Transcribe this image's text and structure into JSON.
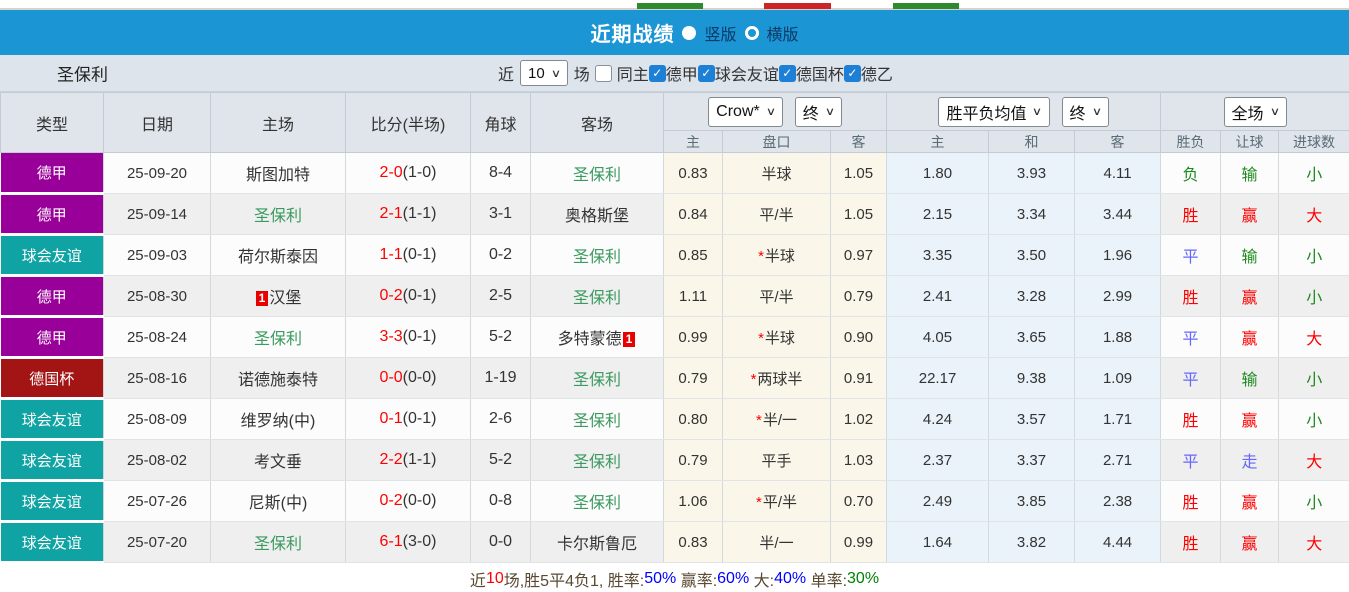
{
  "header": {
    "title": "近期战绩",
    "vertical_label": "竖版",
    "horizontal_label": "横版"
  },
  "filters": {
    "team": "圣保利",
    "recent_label": "近",
    "recent_value": "10",
    "matches_label": "场",
    "same_home_label": "同主",
    "leagues": [
      "德甲",
      "球会友谊",
      "德国杯",
      "德乙"
    ]
  },
  "table": {
    "headers": {
      "type": "类型",
      "date": "日期",
      "home": "主场",
      "score": "比分(半场)",
      "corners": "角球",
      "away": "客场",
      "sub": {
        "asian_home": "主",
        "handicap": "盘口",
        "asian_away": "客",
        "euro_home": "主",
        "euro_draw": "和",
        "euro_away": "客",
        "wdl": "胜负",
        "handicap_result": "让球",
        "goals": "进球数"
      }
    },
    "selects": {
      "asian": "Crow*",
      "asian_state": "终",
      "euro": "胜平负均值",
      "euro_state": "终",
      "result": "全场"
    },
    "rows": [
      {
        "type": "德甲",
        "type_color": "purple",
        "date": "25-09-20",
        "home": {
          "name": "斯图加特",
          "self": false,
          "badge": null
        },
        "score": {
          "full": "2-0",
          "half": "(1-0)"
        },
        "corners": "8-4",
        "away": {
          "name": "圣保利",
          "self": true,
          "badge": null
        },
        "asian": {
          "home": "0.83",
          "handicap": "半球",
          "star": false,
          "away": "1.05"
        },
        "euro": {
          "home": "1.80",
          "draw": "3.93",
          "away": "4.11"
        },
        "result": {
          "wdl": "负",
          "wdl_color": "green",
          "handicap": "输",
          "handicap_color": "green",
          "goals": "小",
          "goals_color": "green"
        }
      },
      {
        "type": "德甲",
        "type_color": "purple",
        "date": "25-09-14",
        "home": {
          "name": "圣保利",
          "self": true,
          "badge": null
        },
        "score": {
          "full": "2-1",
          "half": "(1-1)"
        },
        "corners": "3-1",
        "away": {
          "name": "奥格斯堡",
          "self": false,
          "badge": null
        },
        "asian": {
          "home": "0.84",
          "handicap": "平/半",
          "star": false,
          "away": "1.05"
        },
        "euro": {
          "home": "2.15",
          "draw": "3.34",
          "away": "3.44"
        },
        "result": {
          "wdl": "胜",
          "wdl_color": "red",
          "handicap": "赢",
          "handicap_color": "red",
          "goals": "大",
          "goals_color": "red"
        }
      },
      {
        "type": "球会友谊",
        "type_color": "teal",
        "date": "25-09-03",
        "home": {
          "name": "荷尔斯泰因",
          "self": false,
          "badge": null
        },
        "score": {
          "full": "1-1",
          "half": "(0-1)"
        },
        "corners": "0-2",
        "away": {
          "name": "圣保利",
          "self": true,
          "badge": null
        },
        "asian": {
          "home": "0.85",
          "handicap": "半球",
          "star": true,
          "away": "0.97"
        },
        "euro": {
          "home": "3.35",
          "draw": "3.50",
          "away": "1.96"
        },
        "result": {
          "wdl": "平",
          "wdl_color": "blue",
          "handicap": "输",
          "handicap_color": "green",
          "goals": "小",
          "goals_color": "green"
        }
      },
      {
        "type": "德甲",
        "type_color": "purple",
        "date": "25-08-30",
        "home": {
          "name": "汉堡",
          "self": false,
          "badge": {
            "text": "1",
            "pos": "before"
          }
        },
        "score": {
          "full": "0-2",
          "half": "(0-1)"
        },
        "corners": "2-5",
        "away": {
          "name": "圣保利",
          "self": true,
          "badge": null
        },
        "asian": {
          "home": "1.11",
          "handicap": "平/半",
          "star": false,
          "away": "0.79"
        },
        "euro": {
          "home": "2.41",
          "draw": "3.28",
          "away": "2.99"
        },
        "result": {
          "wdl": "胜",
          "wdl_color": "red",
          "handicap": "赢",
          "handicap_color": "red",
          "goals": "小",
          "goals_color": "green"
        }
      },
      {
        "type": "德甲",
        "type_color": "purple",
        "date": "25-08-24",
        "home": {
          "name": "圣保利",
          "self": true,
          "badge": null
        },
        "score": {
          "full": "3-3",
          "half": "(0-1)"
        },
        "corners": "5-2",
        "away": {
          "name": "多特蒙德",
          "self": false,
          "badge": {
            "text": "1",
            "pos": "after"
          }
        },
        "asian": {
          "home": "0.99",
          "handicap": "半球",
          "star": true,
          "away": "0.90"
        },
        "euro": {
          "home": "4.05",
          "draw": "3.65",
          "away": "1.88"
        },
        "result": {
          "wdl": "平",
          "wdl_color": "blue",
          "handicap": "赢",
          "handicap_color": "red",
          "goals": "大",
          "goals_color": "red"
        }
      },
      {
        "type": "德国杯",
        "type_color": "darkred",
        "date": "25-08-16",
        "home": {
          "name": "诺德施泰特",
          "self": false,
          "badge": null
        },
        "score": {
          "full": "0-0",
          "half": "(0-0)"
        },
        "corners": "1-19",
        "away": {
          "name": "圣保利",
          "self": true,
          "badge": null
        },
        "asian": {
          "home": "0.79",
          "handicap": "两球半",
          "star": true,
          "away": "0.91"
        },
        "euro": {
          "home": "22.17",
          "draw": "9.38",
          "away": "1.09"
        },
        "result": {
          "wdl": "平",
          "wdl_color": "blue",
          "handicap": "输",
          "handicap_color": "green",
          "goals": "小",
          "goals_color": "green"
        }
      },
      {
        "type": "球会友谊",
        "type_color": "teal",
        "date": "25-08-09",
        "home": {
          "name": "维罗纳(中)",
          "self": false,
          "badge": null
        },
        "score": {
          "full": "0-1",
          "half": "(0-1)"
        },
        "corners": "2-6",
        "away": {
          "name": "圣保利",
          "self": true,
          "badge": null
        },
        "asian": {
          "home": "0.80",
          "handicap": "半/一",
          "star": true,
          "away": "1.02"
        },
        "euro": {
          "home": "4.24",
          "draw": "3.57",
          "away": "1.71"
        },
        "result": {
          "wdl": "胜",
          "wdl_color": "red",
          "handicap": "赢",
          "handicap_color": "red",
          "goals": "小",
          "goals_color": "green"
        }
      },
      {
        "type": "球会友谊",
        "type_color": "teal",
        "date": "25-08-02",
        "home": {
          "name": "考文垂",
          "self": false,
          "badge": null
        },
        "score": {
          "full": "2-2",
          "half": "(1-1)"
        },
        "corners": "5-2",
        "away": {
          "name": "圣保利",
          "self": true,
          "badge": null
        },
        "asian": {
          "home": "0.79",
          "handicap": "平手",
          "star": false,
          "away": "1.03"
        },
        "euro": {
          "home": "2.37",
          "draw": "3.37",
          "away": "2.71"
        },
        "result": {
          "wdl": "平",
          "wdl_color": "blue",
          "handicap": "走",
          "handicap_color": "blue",
          "goals": "大",
          "goals_color": "red"
        }
      },
      {
        "type": "球会友谊",
        "type_color": "teal",
        "date": "25-07-26",
        "home": {
          "name": "尼斯(中)",
          "self": false,
          "badge": null
        },
        "score": {
          "full": "0-2",
          "half": "(0-0)"
        },
        "corners": "0-8",
        "away": {
          "name": "圣保利",
          "self": true,
          "badge": null
        },
        "asian": {
          "home": "1.06",
          "handicap": "平/半",
          "star": true,
          "away": "0.70"
        },
        "euro": {
          "home": "2.49",
          "draw": "3.85",
          "away": "2.38"
        },
        "result": {
          "wdl": "胜",
          "wdl_color": "red",
          "handicap": "赢",
          "handicap_color": "red",
          "goals": "小",
          "goals_color": "green"
        }
      },
      {
        "type": "球会友谊",
        "type_color": "teal",
        "date": "25-07-20",
        "home": {
          "name": "圣保利",
          "self": true,
          "badge": null
        },
        "score": {
          "full": "6-1",
          "half": "(3-0)"
        },
        "corners": "0-0",
        "away": {
          "name": "卡尔斯鲁厄",
          "self": false,
          "badge": null
        },
        "asian": {
          "home": "0.83",
          "handicap": "半/一",
          "star": false,
          "away": "0.99"
        },
        "euro": {
          "home": "1.64",
          "draw": "3.82",
          "away": "4.44"
        },
        "result": {
          "wdl": "胜",
          "wdl_color": "red",
          "handicap": "赢",
          "handicap_color": "red",
          "goals": "大",
          "goals_color": "red"
        }
      }
    ]
  },
  "summary": {
    "segments": [
      {
        "text": "近",
        "color": "#5a4a33"
      },
      {
        "text": "10",
        "color": "#ff0000"
      },
      {
        "text": "场,胜5平4负1, 胜率:",
        "color": "#5a4a33"
      },
      {
        "text": "50%",
        "color": "#0000ff"
      },
      {
        "text": " 赢率:",
        "color": "#5a4a33"
      },
      {
        "text": "60%",
        "color": "#0000ff"
      },
      {
        "text": " 大:",
        "color": "#5a4a33"
      },
      {
        "text": "40%",
        "color": "#0000ff"
      },
      {
        "text": " 单率:",
        "color": "#5a4a33"
      },
      {
        "text": "30%",
        "color": "#008000"
      }
    ]
  },
  "colors": {
    "badge": {
      "purple": "#990099",
      "teal": "#10a3a3",
      "darkred": "#a31414"
    },
    "result": {
      "red": "#ff0000",
      "blue": "#6666ff",
      "green": "#1e8a1e"
    },
    "self_team": "#3a9a5f",
    "score_red": "#ff0000",
    "asian_bg": "#faf6ea",
    "euro_bg": "#e9f3f9",
    "title_bar_blue": "#1c95d4"
  },
  "top_strip": {
    "bars": [
      {
        "color": "#2f8a2f"
      },
      {
        "color": "#cc2525"
      },
      {
        "color": "#2f8a2f"
      }
    ]
  }
}
